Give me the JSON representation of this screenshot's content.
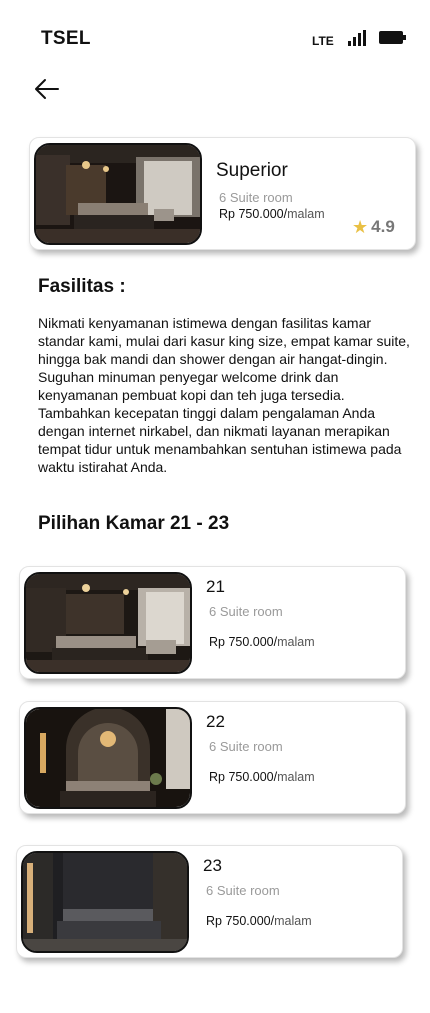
{
  "status": {
    "carrier": "TSEL",
    "network": "LTE"
  },
  "icons": {
    "back": "arrow-left-icon",
    "rating": "star-icon",
    "signal": "signal-icon",
    "battery": "battery-icon"
  },
  "colors": {
    "star": "#e9c044",
    "muted_text": "#9a9a9a"
  },
  "header_room": {
    "name": "Superior",
    "availability": "6 Suite room",
    "price": "Rp 750.000/",
    "price_unit": "malam",
    "rating": "4.9"
  },
  "facilities": {
    "title": "Fasilitas :",
    "description": "Nikmati kenyamanan istimewa dengan fasilitas kamar standar kami, mulai dari kasur king size, empat kamar suite, hingga bak mandi dan shower dengan air hangat-dingin. Suguhan minuman penyegar welcome drink dan kenyamanan pembuat kopi dan teh juga tersedia. Tambahkan kecepatan tinggi dalam pengalaman Anda dengan internet nirkabel, dan nikmati layanan merapikan tempat tidur untuk menambahkan sentuhan istimewa pada waktu istirahat Anda."
  },
  "room_choices": {
    "title": "Pilihan Kamar 21 - 23",
    "rooms": [
      {
        "number": "21",
        "availability": "6 Suite room",
        "price": "Rp 750.000/",
        "price_unit": "malam"
      },
      {
        "number": "22",
        "availability": "6 Suite room",
        "price": "Rp 750.000/",
        "price_unit": "malam"
      },
      {
        "number": "23",
        "availability": "6 Suite room",
        "price": "Rp 750.000/",
        "price_unit": "malam"
      }
    ]
  }
}
